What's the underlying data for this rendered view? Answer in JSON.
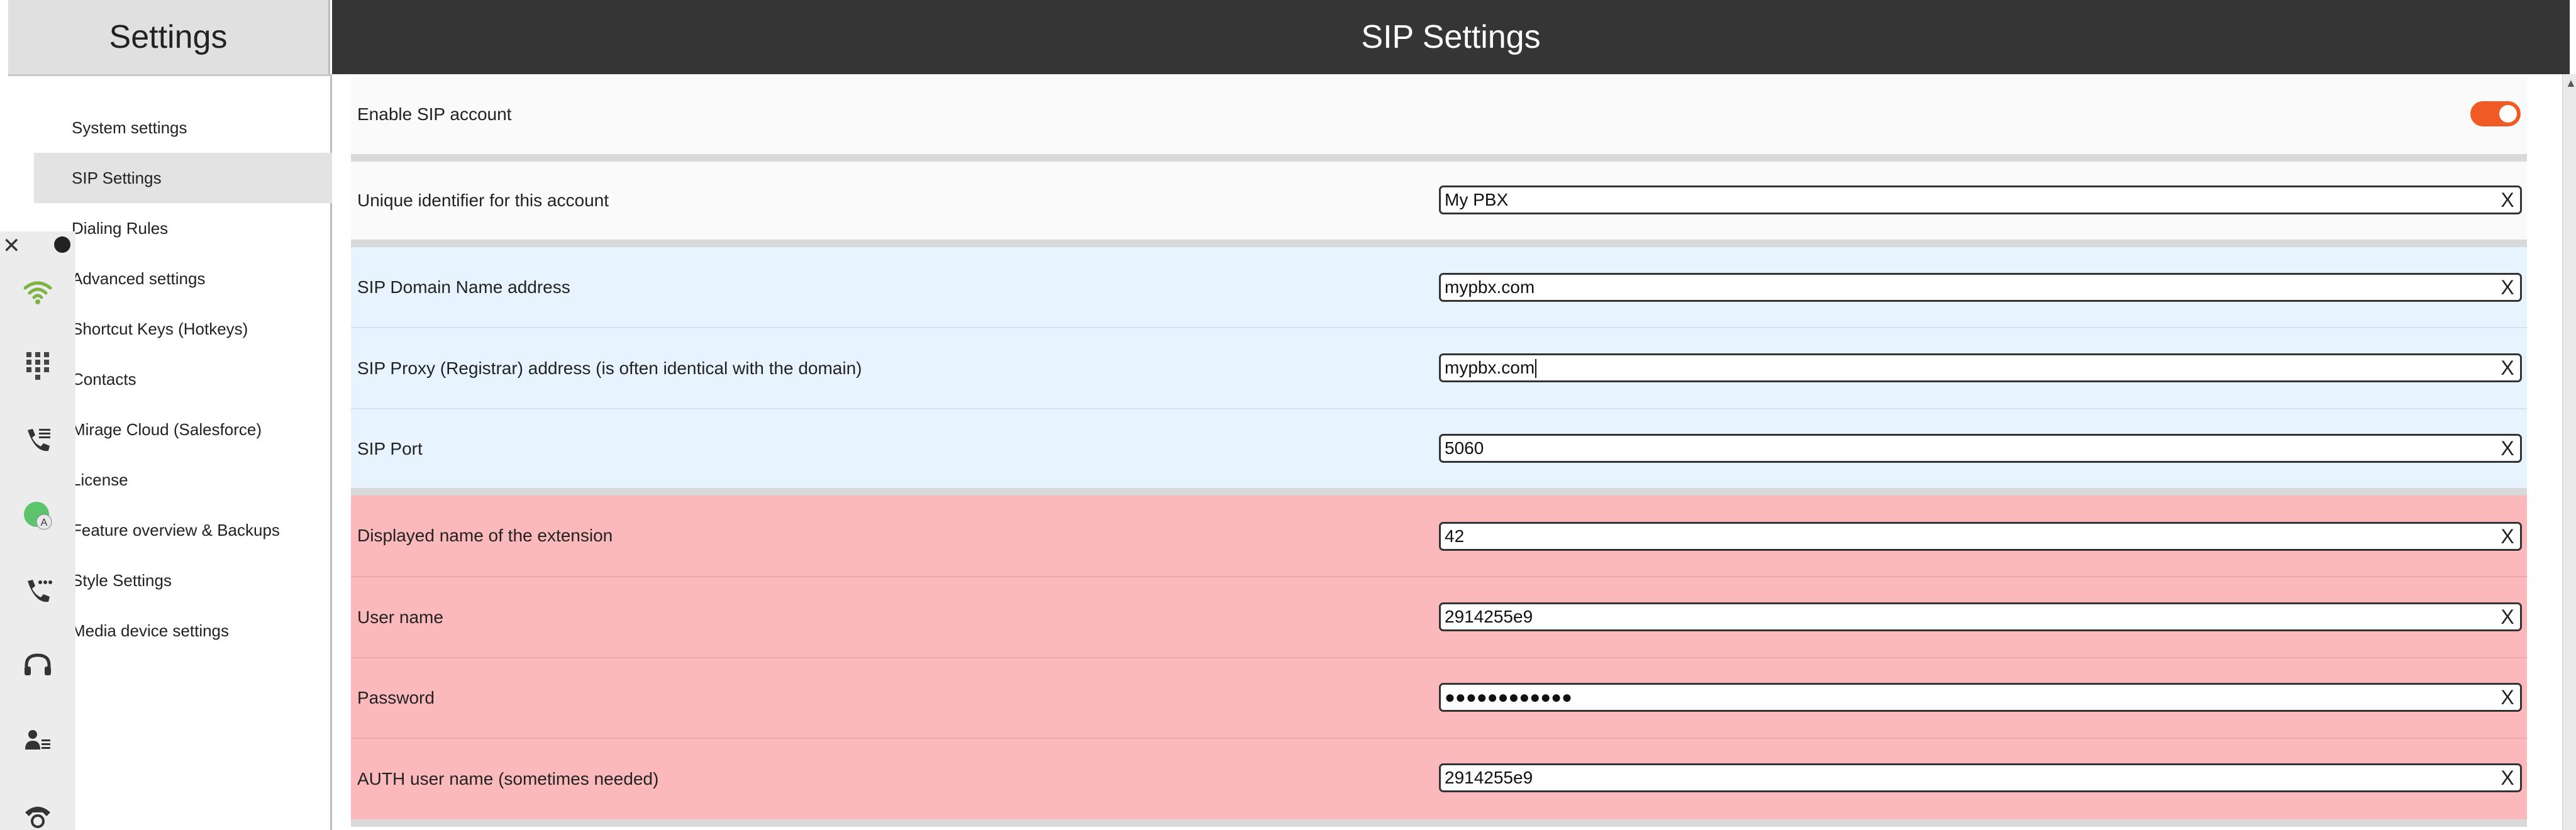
{
  "left_title": "Settings",
  "main_title": "SIP Settings",
  "nav": [
    {
      "label": "System settings",
      "active": false
    },
    {
      "label": "SIP Settings",
      "active": true
    },
    {
      "label": "Dialing Rules",
      "active": false
    },
    {
      "label": "Advanced settings",
      "active": false
    },
    {
      "label": "Shortcut Keys (Hotkeys)",
      "active": false
    },
    {
      "label": "Contacts",
      "active": false
    },
    {
      "label": "Mirage Cloud (Salesforce)",
      "active": false
    },
    {
      "label": "License",
      "active": false
    },
    {
      "label": "Feature overview & Backups",
      "active": false
    },
    {
      "label": "Style Settings",
      "active": false
    },
    {
      "label": "Media device settings",
      "active": false
    }
  ],
  "icon_bar": {
    "close": "✕",
    "icons": [
      "wifi-icon",
      "dialpad-icon",
      "call-list-icon",
      "avatar-status-icon",
      "phone-dots-icon",
      "headset-icon",
      "contact-list-icon",
      "phone-settings-icon"
    ]
  },
  "enable": {
    "label": "Enable SIP account",
    "on": true
  },
  "rows": [
    {
      "label": "Unique identifier for this account",
      "value": "My PBX"
    },
    {
      "label": "SIP Domain Name address",
      "value": "mypbx.com"
    },
    {
      "label": "SIP Proxy (Registrar) address (is often identical with the domain)",
      "value": "mypbx.com"
    },
    {
      "label": "SIP Port",
      "value": "5060"
    },
    {
      "label": "Displayed name of the extension",
      "value": "42"
    },
    {
      "label": "User name",
      "value": "2914255e9"
    },
    {
      "label": "Password",
      "value": "●●●●●●●●●●●●"
    },
    {
      "label": "AUTH user name (sometimes needed)",
      "value": "2914255e9"
    }
  ],
  "clear_label": "X",
  "colors": {
    "header": "#353535",
    "toggle": "#f05a24",
    "blue_row": "#e7f4ff",
    "red_row": "#fbb9bb"
  }
}
